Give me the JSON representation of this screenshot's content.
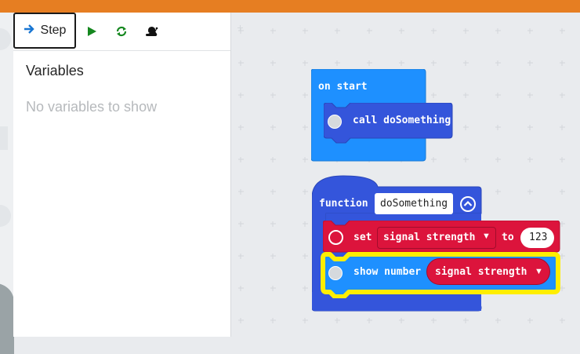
{
  "toolbar": {
    "step_label": "Step",
    "icons": [
      "arrow-right-icon",
      "play-icon",
      "restart-icon",
      "slow-motion-snail-icon"
    ]
  },
  "variables_panel": {
    "title": "Variables",
    "empty_text": "No variables to show"
  },
  "blocks": {
    "on_start": {
      "label": "on start",
      "call_label": "call doSomething"
    },
    "function": {
      "keyword": "function",
      "name": "doSomething",
      "set": {
        "label": "set",
        "variable": "signal strength",
        "to_label": "to",
        "value": "123"
      },
      "show": {
        "label": "show number",
        "variable": "signal strength"
      }
    }
  },
  "colors": {
    "top_bar": "#e67e22",
    "event_block": "#1e90ff",
    "function_block": "#3455db",
    "variable_block": "#dc143c",
    "highlight": "#ffee00",
    "basic_block": "#1e90ff"
  }
}
